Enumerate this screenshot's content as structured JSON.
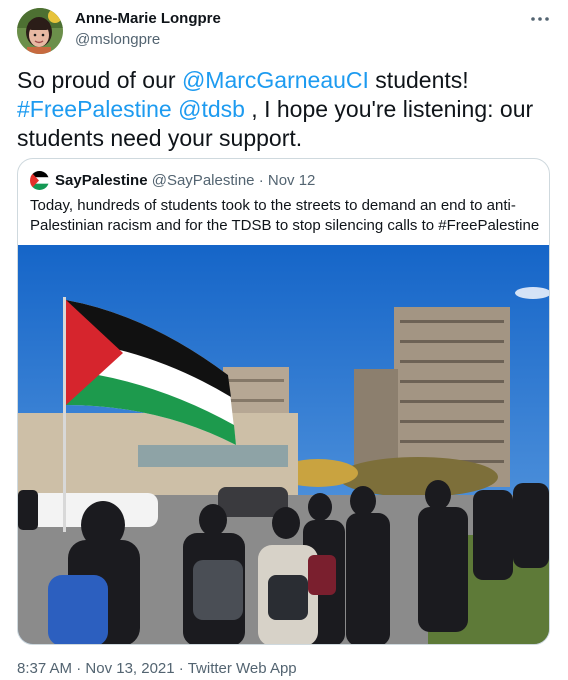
{
  "author": {
    "name": "Anne-Marie Longpre",
    "handle": "@mslongpre"
  },
  "tweet": {
    "mention_1": "@MarcGarneauCI",
    "text_1": "So proud of our ",
    "text_2": " students!",
    "hashtag_1": "#FreePalestine",
    "mention_2": "@tdsb",
    "text_3": " , I hope you're listening: our students need your support."
  },
  "quoted": {
    "name": "SayPalestine",
    "handle": "@SayPalestine",
    "separator": "·",
    "date": "Nov 12",
    "text": "Today, hundreds of students took to the streets to demand an end to anti-Palestinian racism and for the TDSB to stop silencing calls to ",
    "hashtag": "#FreePalestine",
    "photo_icon": "protest-photo"
  },
  "meta": {
    "time": "8:37 AM",
    "separator": "·",
    "date": "Nov 13, 2021",
    "source": "Twitter Web App"
  },
  "colors": {
    "link": "#1d9bf0",
    "secondary_text": "#536471",
    "border": "#cfd9de"
  }
}
